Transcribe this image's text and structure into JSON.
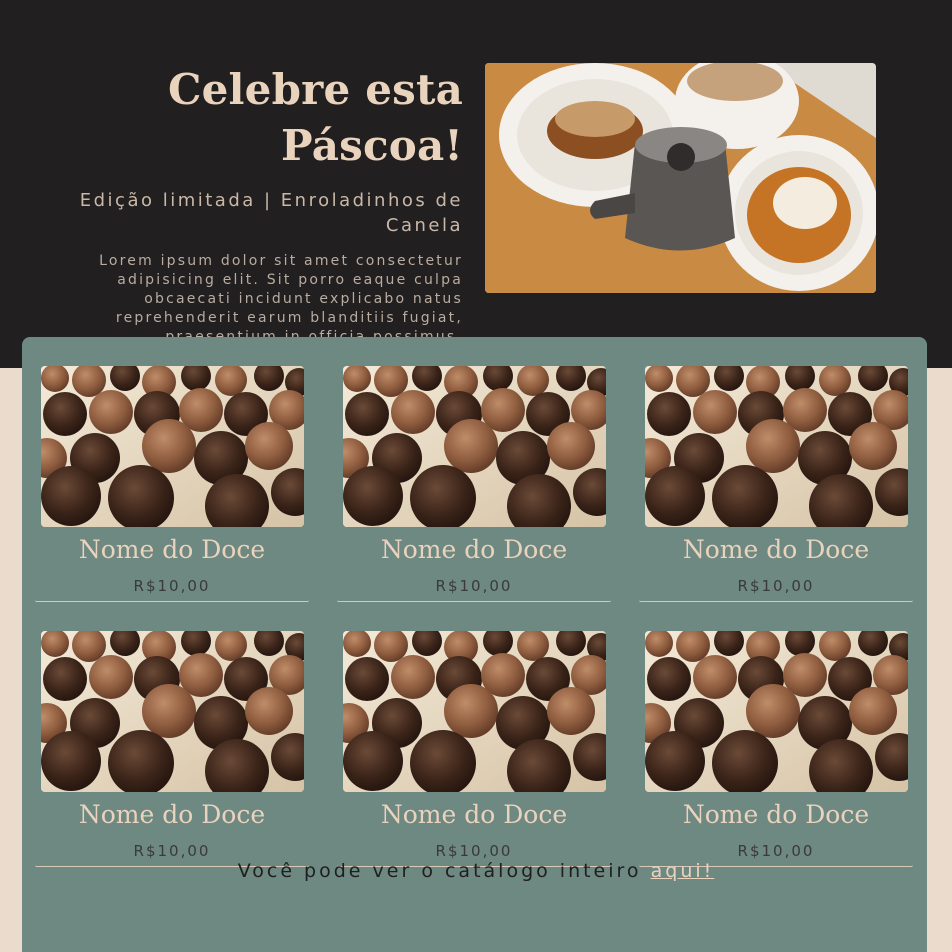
{
  "hero": {
    "title": "Celebre esta Páscoa!",
    "subtitle": "Edição limitada | Enroladinhos de Canela",
    "body": "Lorem ipsum dolor sit amet consectetur adipisicing elit. Sit porro eaque culpa obcaecati incidunt explicabo natus reprehenderit earum blanditiis fugiat, praesentium in officia possimus.",
    "photo_icon": "cinnamon-rolls-coffee-photo"
  },
  "products": [
    {
      "name": "Nome do Doce",
      "price": "R$10,00",
      "photo_icon": "brigadeiro-truffles-photo"
    },
    {
      "name": "Nome do Doce",
      "price": "R$10,00",
      "photo_icon": "brigadeiro-truffles-photo"
    },
    {
      "name": "Nome do Doce",
      "price": "R$10,00",
      "photo_icon": "brigadeiro-truffles-photo"
    },
    {
      "name": "Nome do Doce",
      "price": "R$10,00",
      "photo_icon": "brigadeiro-truffles-photo"
    },
    {
      "name": "Nome do Doce",
      "price": "R$10,00",
      "photo_icon": "brigadeiro-truffles-photo"
    },
    {
      "name": "Nome do Doce",
      "price": "R$10,00",
      "photo_icon": "brigadeiro-truffles-photo"
    }
  ],
  "footer": {
    "text": "Você pode ver o catálogo inteiro",
    "link": "aqui!"
  },
  "colors": {
    "hero_bg": "#221f20",
    "page_bg": "#eadbcd",
    "catalog_bg": "#6e8882",
    "accent": "#ead3bd"
  }
}
